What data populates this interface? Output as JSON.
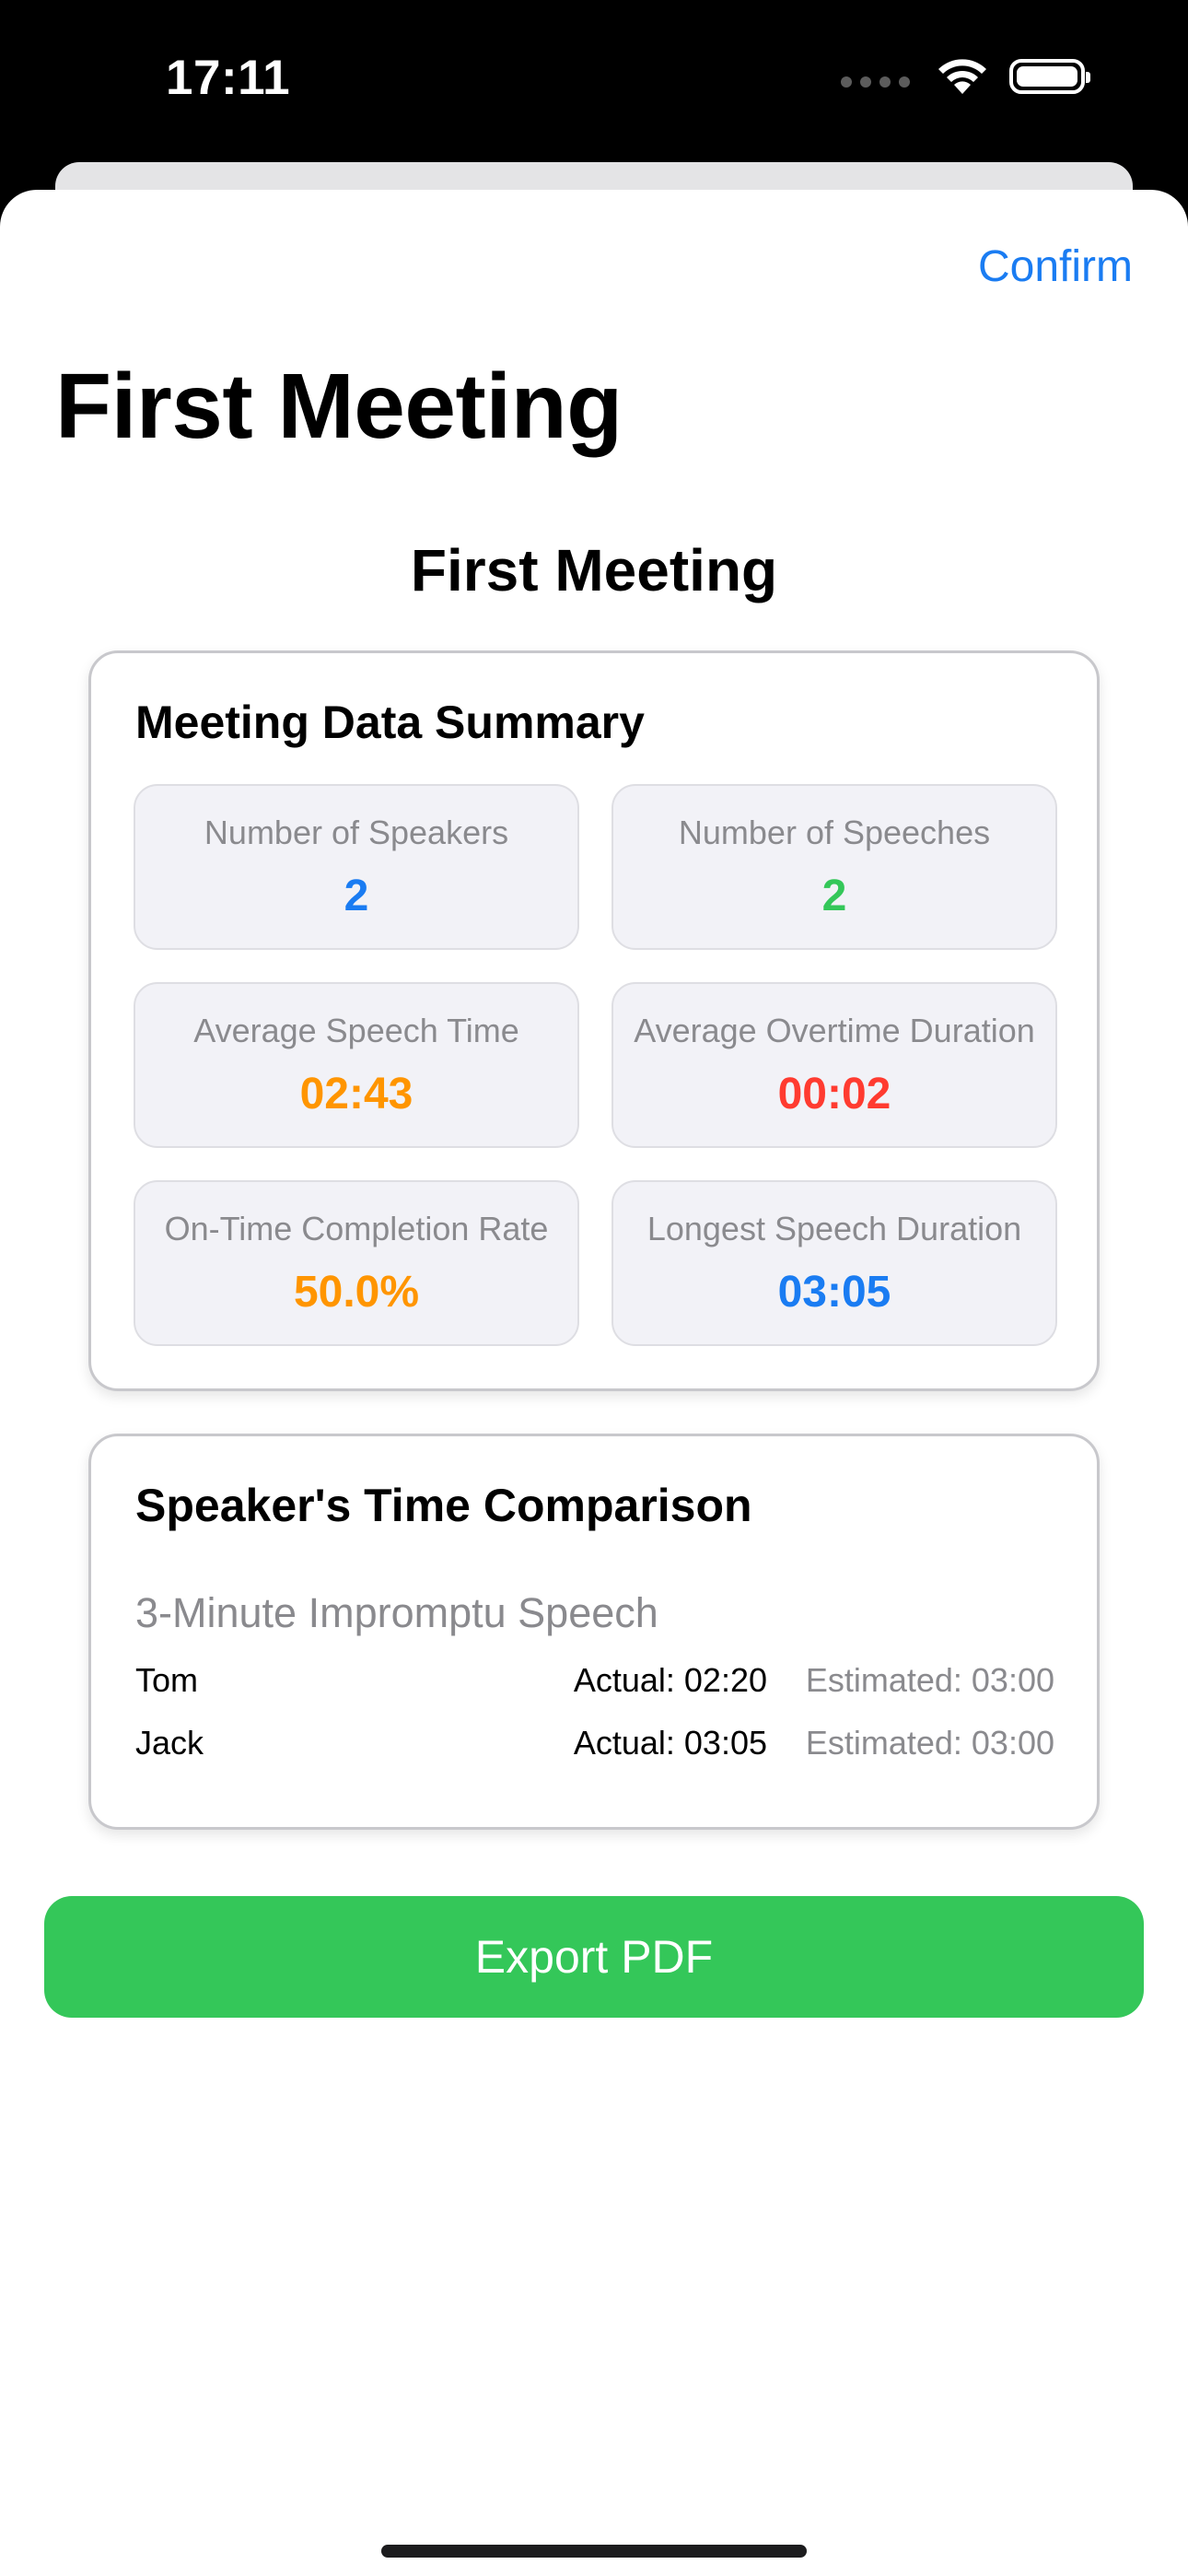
{
  "status_bar": {
    "time": "17:11",
    "icons": [
      "cellular-dots-icon",
      "wifi-icon",
      "battery-icon"
    ]
  },
  "nav": {
    "confirm_label": "Confirm",
    "large_title": "First Meeting"
  },
  "report": {
    "title": "First Meeting"
  },
  "summary": {
    "title": "Meeting Data Summary",
    "stats": [
      {
        "label": "Number of Speakers",
        "value": "2",
        "color": "#1a7cf2"
      },
      {
        "label": "Number of Speeches",
        "value": "2",
        "color": "#34c759"
      },
      {
        "label": "Average Speech Time",
        "value": "02:43",
        "color": "#ff9500"
      },
      {
        "label": "Average Overtime Duration",
        "value": "00:02",
        "color": "#ff3b30"
      },
      {
        "label": "On-Time Completion Rate",
        "value": "50.0%",
        "color": "#ff9500"
      },
      {
        "label": "Longest Speech Duration",
        "value": "03:05",
        "color": "#1a7cf2"
      }
    ]
  },
  "comparison": {
    "title": "Speaker's Time Comparison",
    "section": "3-Minute Impromptu Speech",
    "rows": [
      {
        "name": "Tom",
        "actual": "Actual: 02:20",
        "estimated": "Estimated: 03:00"
      },
      {
        "name": "Jack",
        "actual": "Actual: 03:05",
        "estimated": "Estimated: 03:00"
      }
    ]
  },
  "export": {
    "label": "Export PDF",
    "color": "#34c759"
  }
}
